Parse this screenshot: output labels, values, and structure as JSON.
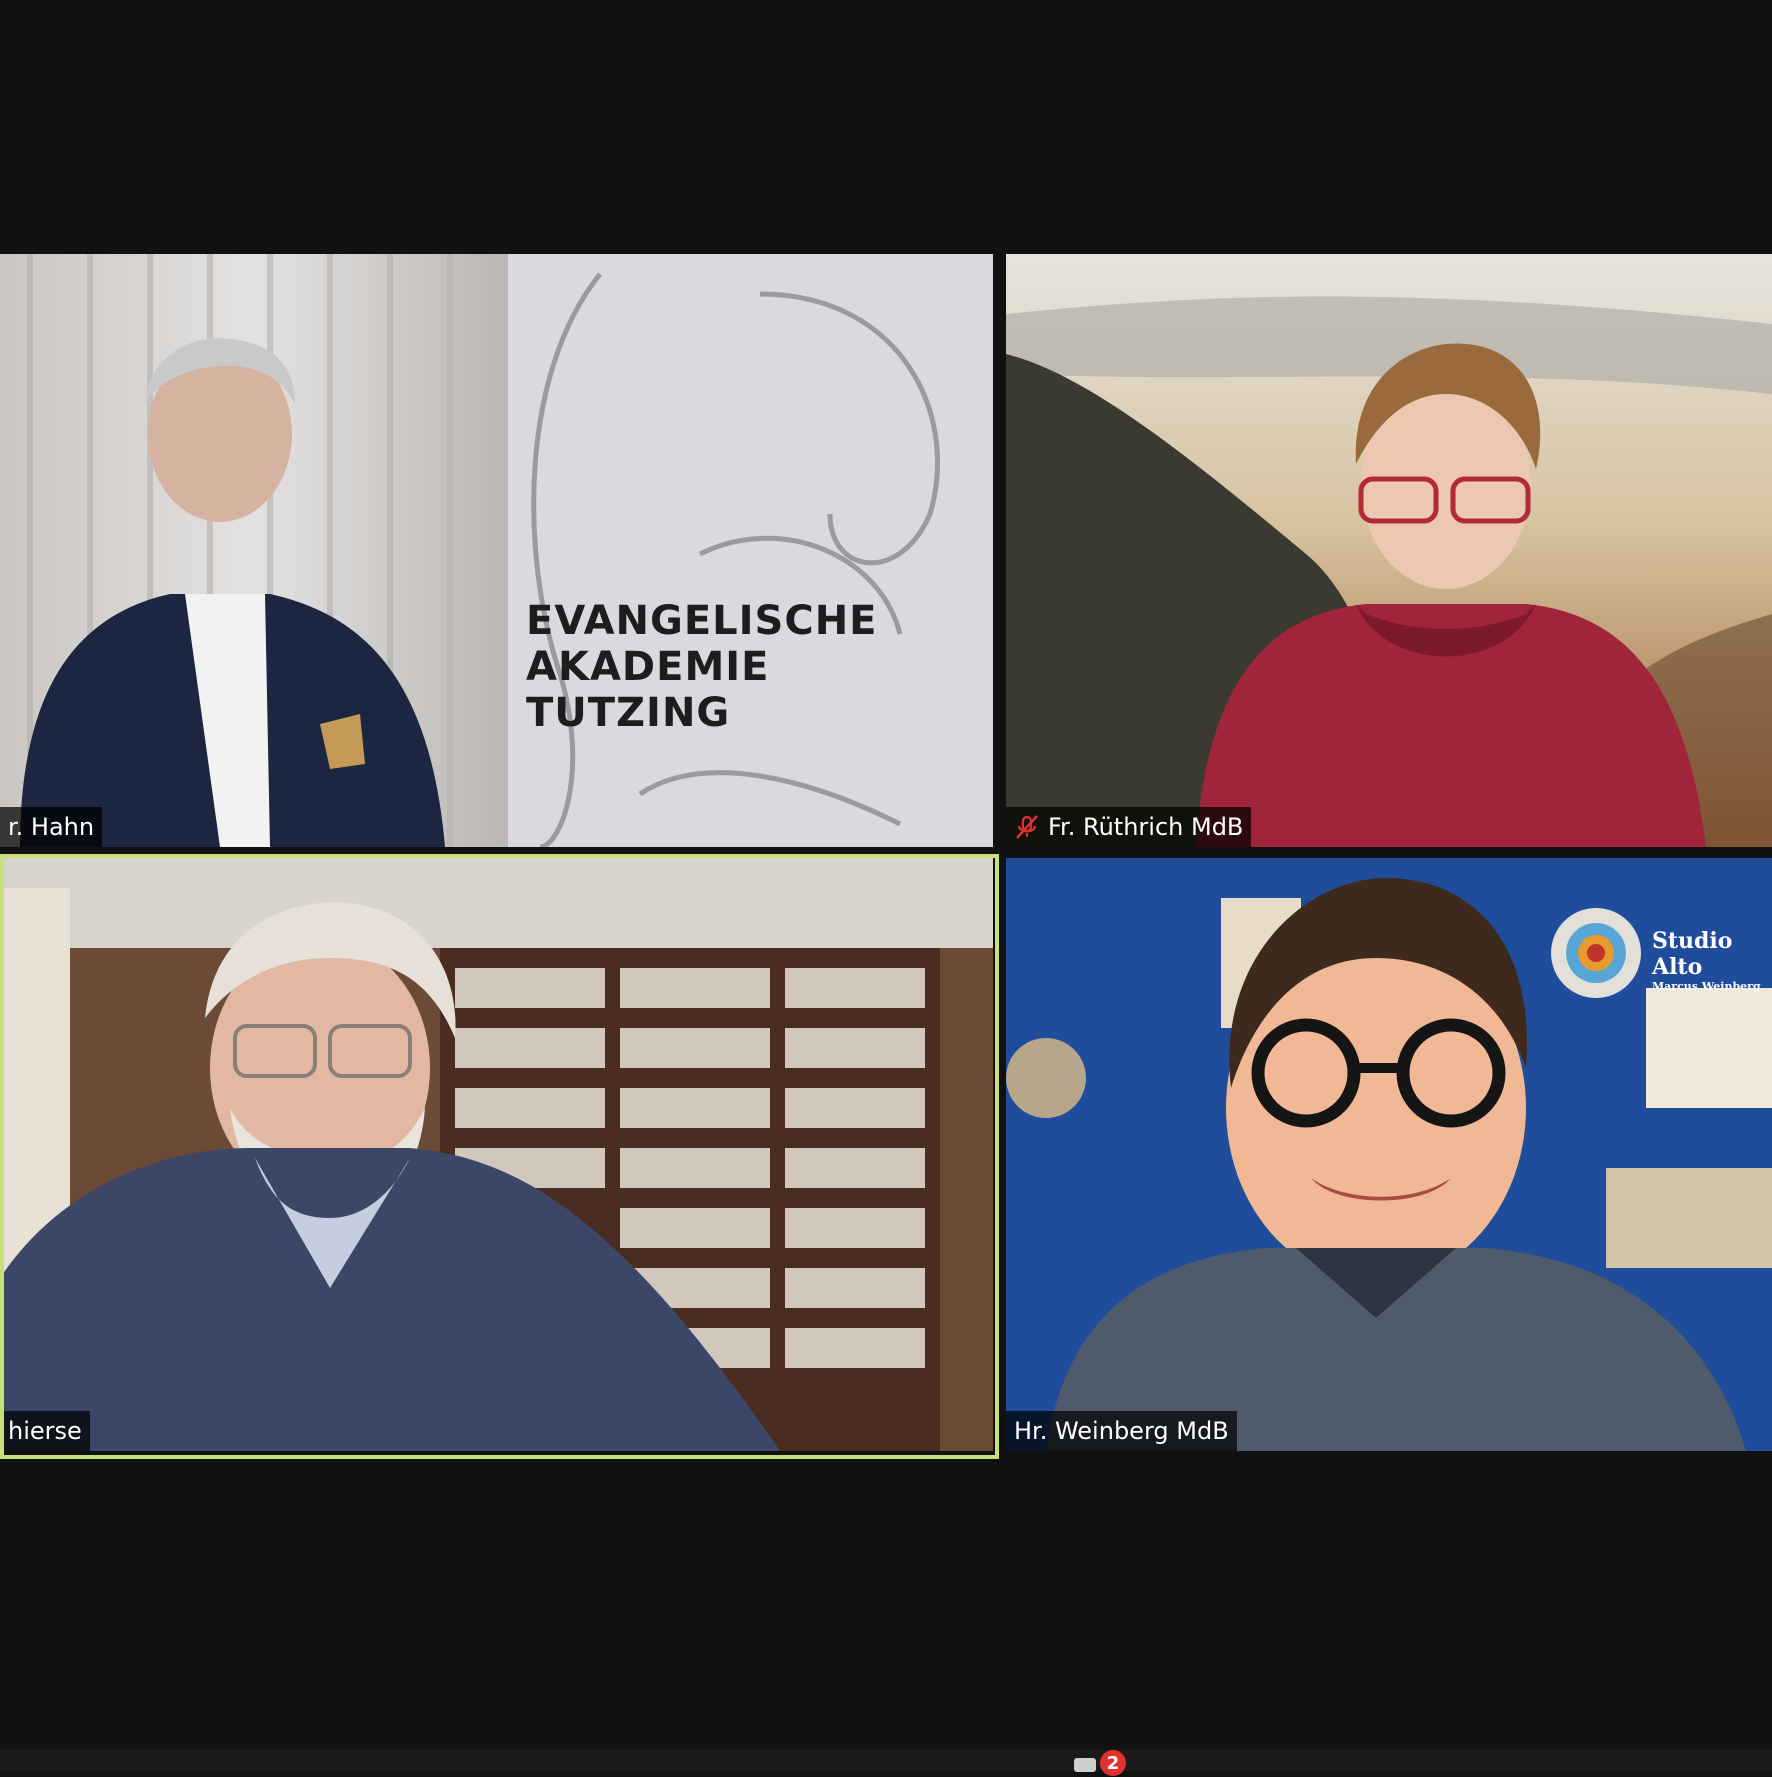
{
  "participants": [
    {
      "name": "r. Hahn",
      "muted": false
    },
    {
      "name": "Fr. Rüthrich MdB",
      "muted": true
    },
    {
      "name": "hierse",
      "muted": false,
      "active_speaker": true
    },
    {
      "name": "Hr. Weinberg MdB",
      "muted": false
    }
  ],
  "backgrounds": {
    "hahn_banner_line1": "EVANGELISCHE AKADEMIE",
    "hahn_banner_line2": "TUTZING",
    "weinberg_logo_title": "Studio Alto",
    "weinberg_logo_subtitle": "Marcus Weinberg"
  },
  "chat": {
    "unread_count": "2"
  },
  "colors": {
    "active_speaker_border": "#c8e07a",
    "muted_icon": "#e0312e",
    "badge": "#e0312e"
  },
  "icons": {
    "muted": "mic-muted-icon",
    "chat": "chat-icon"
  }
}
